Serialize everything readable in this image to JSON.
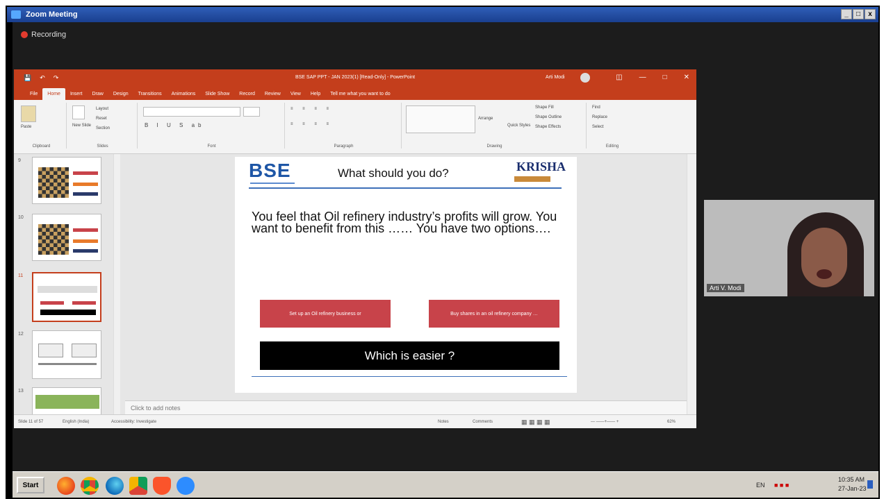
{
  "window": {
    "title": "Zoom Meeting",
    "controls": [
      "_",
      "7",
      "x"
    ]
  },
  "recording": {
    "label": "Recording"
  },
  "powerpoint": {
    "title": "BSE SAP PPT - JAN 2023(1) [Read-Only] - PowerPoint",
    "user": "Arti Modi",
    "tabs": [
      "File",
      "Home",
      "Insert",
      "Draw",
      "Design",
      "Transitions",
      "Animations",
      "Slide Show",
      "Record",
      "Review",
      "View",
      "Help",
      "Tell me what you want to do"
    ],
    "ribbon": {
      "clipboard": {
        "label": "Clipboard",
        "paste": "Paste"
      },
      "slides": {
        "label": "Slides",
        "new_slide": "New Slide",
        "layout": "Layout",
        "reset": "Reset",
        "section": "Section"
      },
      "font": {
        "label": "Font"
      },
      "paragraph": {
        "label": "Paragraph"
      },
      "drawing": {
        "label": "Drawing",
        "arrange": "Arrange",
        "quick_styles": "Quick Styles",
        "shape_fill": "Shape Fill",
        "shape_outline": "Shape Outline",
        "shape_effects": "Shape Effects"
      },
      "editing": {
        "label": "Editing",
        "find": "Find",
        "replace": "Replace",
        "select": "Select"
      }
    },
    "thumbnails": [
      {
        "num": "9"
      },
      {
        "num": "10"
      },
      {
        "num": "11"
      },
      {
        "num": "12"
      },
      {
        "num": "13"
      }
    ],
    "slide": {
      "logo_left": "BSE",
      "title": "What should you do?",
      "logo_right": "KRISHA",
      "body": "You feel that Oil refinery industry’s profits will grow. You want to benefit from this …… You have two options….",
      "option_left": "Set up an Oil refinery business or",
      "option_right": "Buy shares in an oil refinery company …",
      "question": "Which is easier ?"
    },
    "notes_placeholder": "Click to add notes",
    "status": {
      "slide_info": "Slide 11 of 57",
      "language": "English (India)",
      "accessibility": "Accessibility: Investigate",
      "notes": "Notes",
      "comments": "Comments",
      "zoom": "62%"
    }
  },
  "video": {
    "participant": "Arti V. Modi"
  },
  "taskbar": {
    "start": "Start",
    "language": "EN",
    "time": "10:35 AM",
    "date": "27-Jan-23"
  }
}
